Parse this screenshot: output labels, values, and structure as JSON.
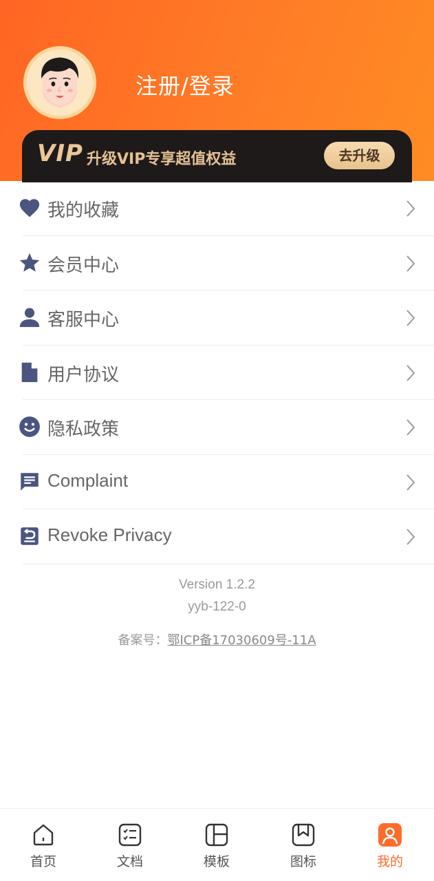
{
  "header": {
    "login_label": "注册/登录",
    "vip_logo": "VIP",
    "vip_text": "升级VIP专享超值权益",
    "vip_button_label": "去升级"
  },
  "colors": {
    "header_gradient_start": "#ff6523",
    "header_gradient_end": "#ff8c24",
    "icon_blue": "#4a5580",
    "active_tab": "#ff6b2b",
    "vip_banner_bg": "#1f1a1a",
    "vip_gold": "#e4c294"
  },
  "menu": {
    "items": [
      {
        "label": "我的收藏",
        "icon": "heart-icon"
      },
      {
        "label": "会员中心",
        "icon": "star-icon"
      },
      {
        "label": "客服中心",
        "icon": "person-icon"
      },
      {
        "label": "用户协议",
        "icon": "document-icon"
      },
      {
        "label": "隐私政策",
        "icon": "smiley-icon"
      },
      {
        "label": "Complaint",
        "icon": "chat-icon"
      },
      {
        "label": "Revoke Privacy",
        "icon": "revoke-icon"
      }
    ]
  },
  "footer": {
    "version": "Version 1.2.2",
    "build": "yyb-122-0",
    "icp_prefix": "备案号：",
    "icp_link": "鄂ICP备17030609号-11A"
  },
  "tabbar": {
    "tabs": [
      {
        "label": "首页",
        "icon": "home-icon"
      },
      {
        "label": "文档",
        "icon": "document-list-icon"
      },
      {
        "label": "模板",
        "icon": "template-icon"
      },
      {
        "label": "图标",
        "icon": "bookmark-icon"
      },
      {
        "label": "我的",
        "icon": "profile-icon",
        "active": true
      }
    ]
  }
}
